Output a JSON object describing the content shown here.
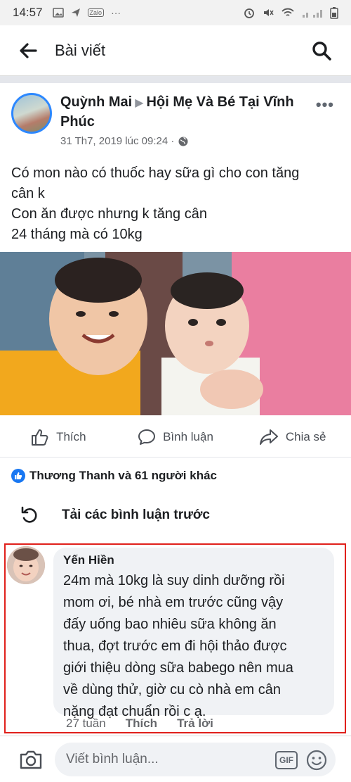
{
  "status_bar": {
    "time": "14:57",
    "app_icons": [
      "image-icon",
      "send-icon",
      "zalo-icon",
      "more-icon"
    ],
    "zalo": "Zalo",
    "more": "···"
  },
  "header": {
    "title": "Bài viết"
  },
  "post": {
    "author": "Quỳnh Mai",
    "group": "Hội Mẹ Và Bé Tại Vĩnh Phúc",
    "timestamp": "31 Th7, 2019 lúc 09:24 ·",
    "text_lines": [
      "Có mon nào có thuốc hay sữa gì cho con tăng",
      "cân k",
      "Con ăn được nhưng k tăng cân",
      "24 tháng mà có 10kg"
    ],
    "more": "•••"
  },
  "actions": {
    "like": "Thích",
    "comment": "Bình luận",
    "share": "Chia sẻ"
  },
  "reactions": {
    "text": "Thương Thanh và 61 người khác"
  },
  "load_previous": "Tải các bình luận trước",
  "comment": {
    "author": "Yến Hiền",
    "text_lines": [
      "24m mà 10kg là suy dinh dưỡng rồi",
      "mom ơi, bé nhà em trước cũng vậy",
      "đấy uống bao nhiêu sữa không ăn",
      "thua, đợt trước em đi hội thảo được",
      "giới thiệu dòng sữa babego nên mua",
      "về dùng thử, giờ cu cò nhà em cân",
      "nặng đạt chuẩn rồi c ạ."
    ],
    "time": "27 tuần",
    "like": "Thích",
    "reply": "Trả lời"
  },
  "composer": {
    "placeholder": "Viết bình luận...",
    "gif": "GIF"
  },
  "colors": {
    "accent": "#1877f2",
    "highlight": "#e0201b"
  }
}
